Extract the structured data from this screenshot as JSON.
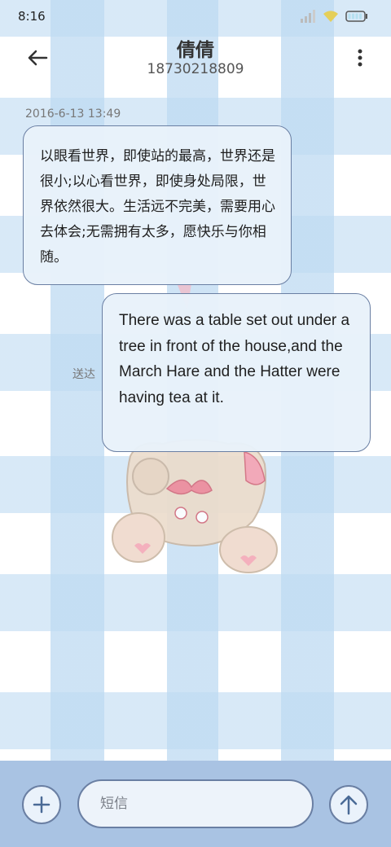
{
  "status_bar": {
    "time": "8:16"
  },
  "header": {
    "contact_name": "倩倩",
    "contact_number": "18730218809"
  },
  "conversation": {
    "timestamp": "2016-6-13 13:49",
    "incoming_message": "以眼看世界，即使站的最高，世界还是很小;以心看世界，即使身处局限，世界依然很大。生活远不完美，需要用心去体会;无需拥有太多，愿快乐与你相随。",
    "outgoing_message": "There was a table set out under a tree in front of the house,and the March Hare and the Hatter were having tea at it.",
    "delivery_status": "送达"
  },
  "composer": {
    "placeholder": "短信"
  },
  "colors": {
    "bubble_border": "#6a7fa3",
    "bubble_fill": "#e8f1fa",
    "composer_bg": "#a9c3e3"
  },
  "icons": [
    "back-arrow-icon",
    "more-vertical-icon",
    "signal-icon",
    "wifi-icon",
    "battery-icon",
    "plus-icon",
    "send-arrow-icon"
  ]
}
